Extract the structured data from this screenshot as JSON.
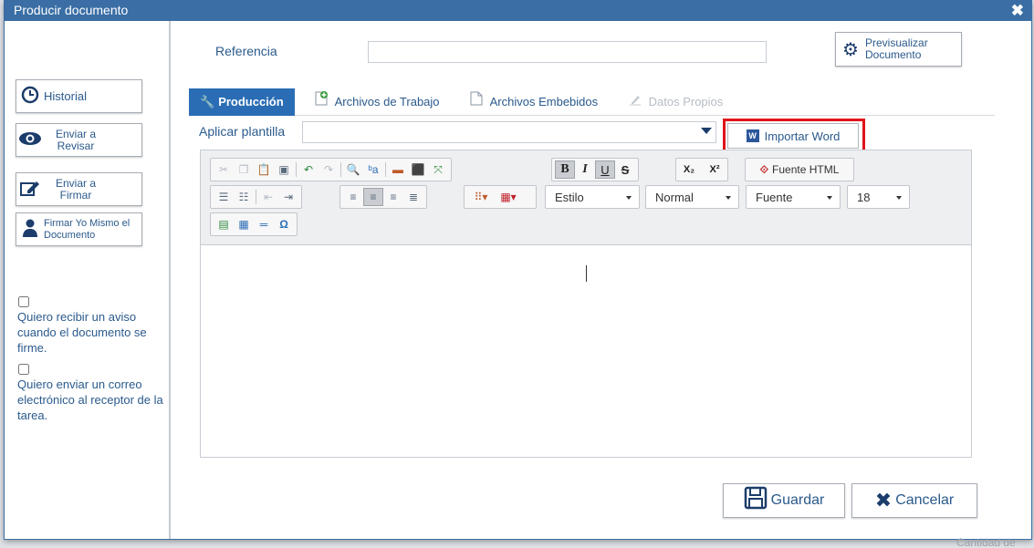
{
  "dialog": {
    "title": "Producir documento",
    "close_icon": "close-icon"
  },
  "sidebar": {
    "history_label": "Historial",
    "send_review_label": "Enviar a Revisar",
    "send_sign_label": "Enviar a Firmar",
    "sign_myself_label": "Firmar Yo Mismo el Documento",
    "notify_checkbox_label": "Quiero recibir un aviso cuando el documento se firme.",
    "email_checkbox_label": "Quiero enviar un correo electrónico al receptor de la tarea."
  },
  "main": {
    "reference_label": "Referencia",
    "reference_value": "",
    "preview_label": "Previsualizar Documento",
    "tabs": [
      {
        "label": "Producción",
        "state": "active"
      },
      {
        "label": "Archivos de Trabajo",
        "state": "normal"
      },
      {
        "label": "Archivos Embebidos",
        "state": "normal"
      },
      {
        "label": "Datos Propios",
        "state": "disabled"
      }
    ],
    "template_label": "Aplicar plantilla",
    "template_value": "",
    "import_word_label": "Importar Word",
    "import_word_icon_text": "W",
    "highlight_color": "#e0141b"
  },
  "editor": {
    "source_label": "Fuente HTML",
    "style_combo": "Estilo",
    "format_combo": "Normal",
    "font_combo": "Fuente",
    "size_combo": "18",
    "bold_glyph": "B",
    "italic_glyph": "I",
    "underline_glyph": "U",
    "strike_glyph": "S",
    "subscript_glyph": "X₂",
    "superscript_glyph": "X²",
    "omega_glyph": "Ω",
    "content": ""
  },
  "actions": {
    "save_label": "Guardar",
    "cancel_label": "Cancelar"
  },
  "footer": {
    "hint_text": "Cantidad de"
  },
  "colors": {
    "titlebar": "#3a6ea5",
    "active_tab": "#2a6db5",
    "link_text": "#2a5a8c"
  }
}
